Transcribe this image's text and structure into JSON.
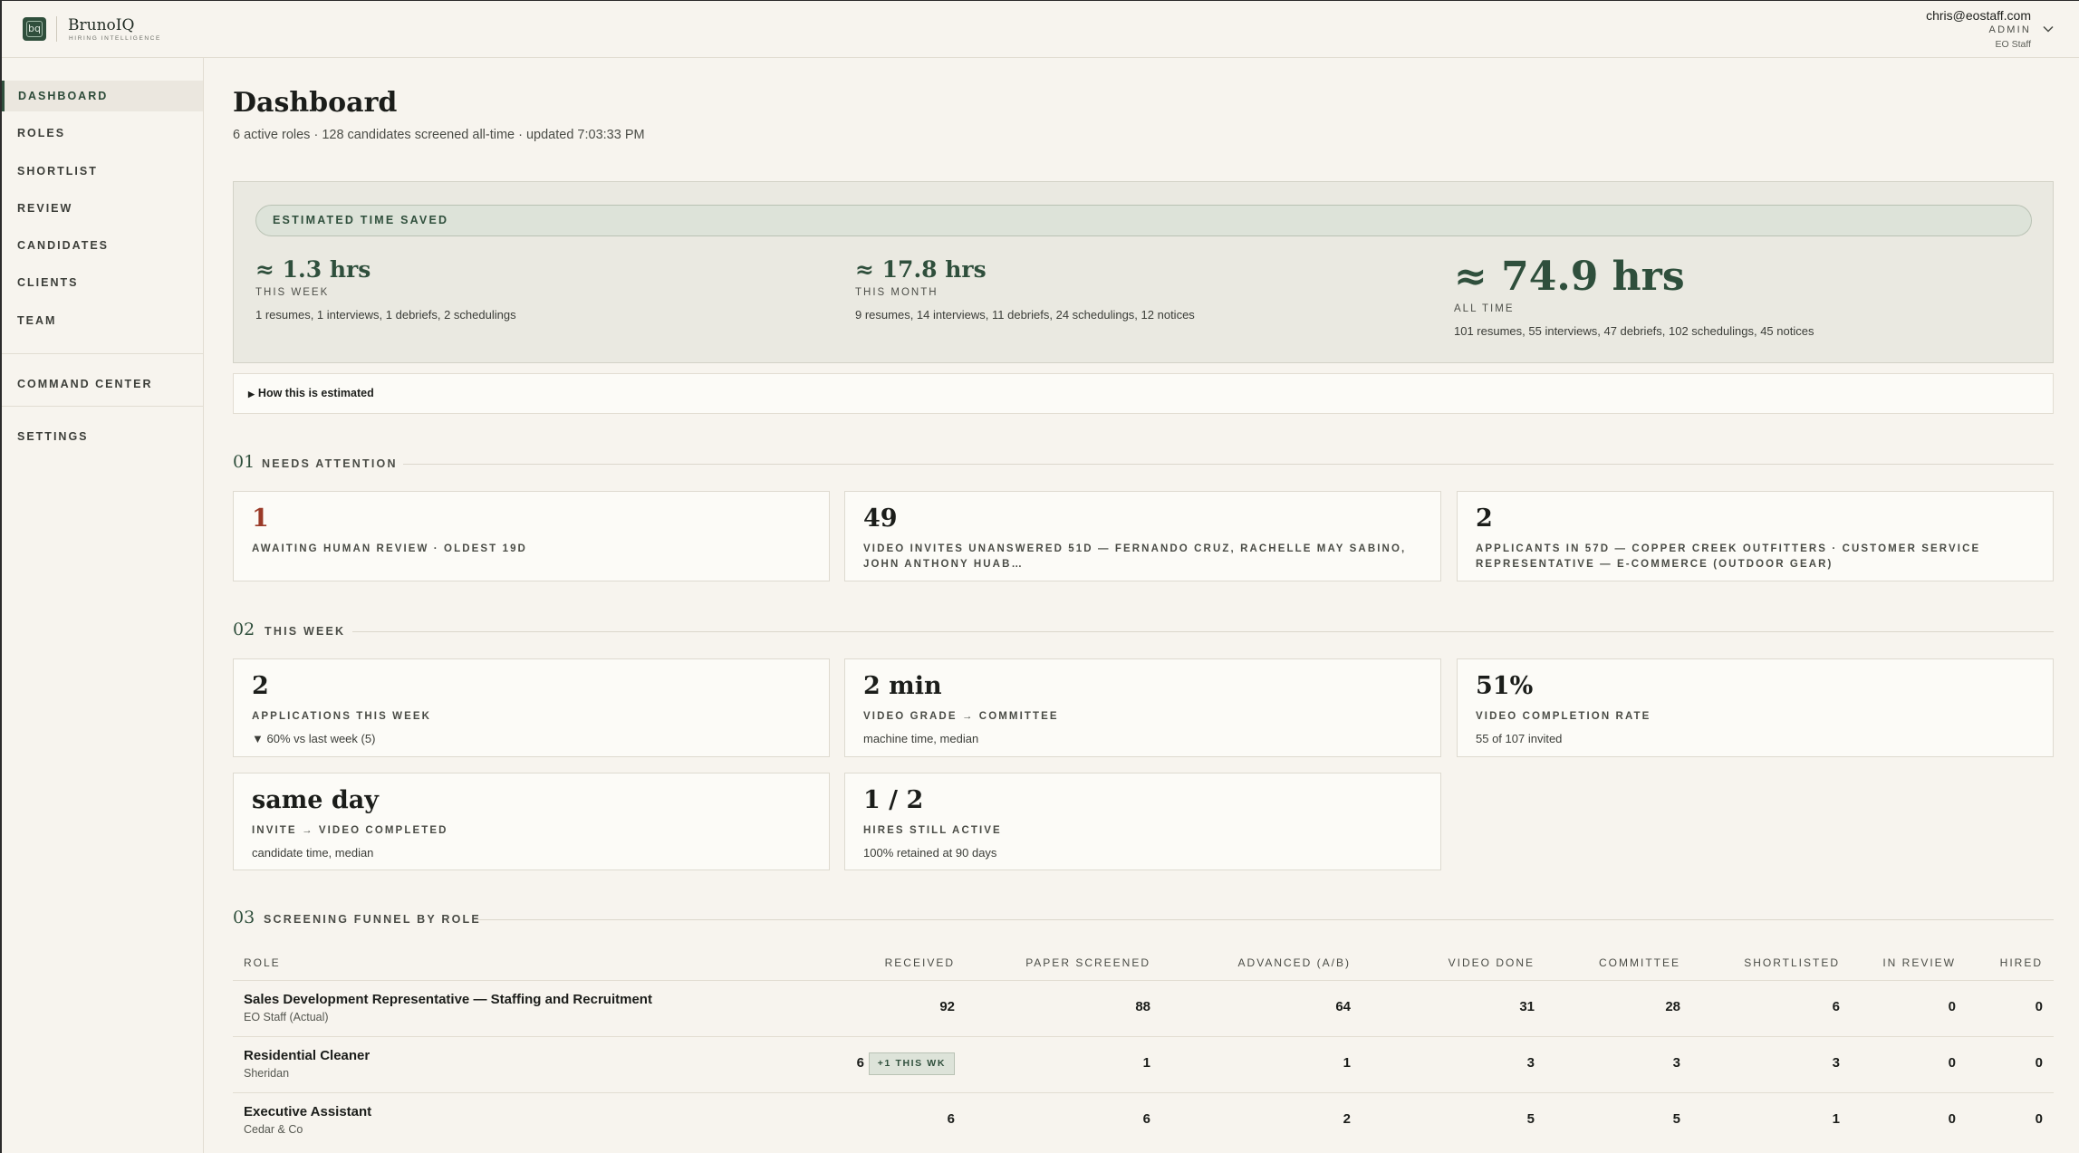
{
  "brand": {
    "mark": "bq",
    "name": "BrunoIQ",
    "tagline": "HIRING INTELLIGENCE"
  },
  "user": {
    "email": "chris@eostaff.com",
    "role": "ADMIN",
    "org": "EO Staff"
  },
  "sidebar": {
    "items": [
      {
        "label": "DASHBOARD",
        "active": true
      },
      {
        "label": "ROLES"
      },
      {
        "label": "SHORTLIST"
      },
      {
        "label": "REVIEW"
      },
      {
        "label": "CANDIDATES"
      },
      {
        "label": "CLIENTS"
      },
      {
        "label": "TEAM"
      }
    ],
    "command_center": "COMMAND CENTER",
    "settings": "SETTINGS"
  },
  "page": {
    "title": "Dashboard",
    "subtitle": "6 active roles · 128 candidates screened all-time · updated 7:03:33 PM"
  },
  "time_saved": {
    "heading": "ESTIMATED TIME SAVED",
    "week": {
      "value": "≈ 1.3 hrs",
      "label": "THIS WEEK",
      "desc": "1 resumes, 1 interviews, 1 debriefs, 2 schedulings"
    },
    "month": {
      "value": "≈ 17.8 hrs",
      "label": "THIS MONTH",
      "desc": "9 resumes, 14 interviews, 11 debriefs, 24 schedulings, 12 notices"
    },
    "all": {
      "value": "≈ 74.9 hrs",
      "label": "ALL TIME",
      "desc": "101 resumes, 55 interviews, 47 debriefs, 102 schedulings, 45 notices"
    },
    "how": "How this is estimated"
  },
  "needs_attention": {
    "num": "01",
    "title": "NEEDS ATTENTION",
    "cards": [
      {
        "value": "1",
        "label": "AWAITING HUMAN REVIEW · OLDEST 19D"
      },
      {
        "value": "49",
        "label": "VIDEO INVITES UNANSWERED 51D — FERNANDO CRUZ, RACHELLE MAY SABINO, JOHN ANTHONY HUAB…"
      },
      {
        "value": "2",
        "label": "APPLICANTS IN 57D — COPPER CREEK OUTFITTERS · CUSTOMER SERVICE REPRESENTATIVE — E-COMMERCE (OUTDOOR GEAR)"
      }
    ]
  },
  "this_week": {
    "num": "02",
    "title": "THIS WEEK",
    "cards": [
      {
        "value": "2",
        "label": "APPLICATIONS THIS WEEK",
        "note": "▼ 60% vs last week (5)"
      },
      {
        "value": "2 min",
        "label": "VIDEO GRADE → COMMITTEE",
        "note": "machine time, median"
      },
      {
        "value": "51%",
        "label": "VIDEO COMPLETION RATE",
        "note": "55 of 107 invited"
      },
      {
        "value": "same day",
        "label": "INVITE → VIDEO COMPLETED",
        "note": "candidate time, median"
      },
      {
        "value": "1 / 2",
        "label": "HIRES STILL ACTIVE",
        "note": "100% retained at 90 days"
      }
    ]
  },
  "funnel": {
    "num": "03",
    "title": "SCREENING FUNNEL BY ROLE",
    "columns": [
      "ROLE",
      "RECEIVED",
      "PAPER SCREENED",
      "ADVANCED (A/B)",
      "VIDEO DONE",
      "COMMITTEE",
      "SHORTLISTED",
      "IN REVIEW",
      "HIRED"
    ],
    "rows": [
      {
        "role": "Sales Development Representative — Staffing and Recruitment",
        "client": "EO Staff (Actual)",
        "tag": "",
        "values": [
          "92",
          "88",
          "64",
          "31",
          "28",
          "6",
          "0",
          "0"
        ]
      },
      {
        "role": "Residential Cleaner",
        "client": "Sheridan",
        "tag": "+1 THIS WK",
        "values": [
          "6",
          "1",
          "1",
          "3",
          "3",
          "3",
          "0",
          "0"
        ]
      },
      {
        "role": "Executive Assistant",
        "client": "Cedar & Co",
        "tag": "",
        "values": [
          "6",
          "6",
          "2",
          "5",
          "5",
          "1",
          "0",
          "0"
        ]
      }
    ]
  },
  "colors": {
    "accent": "#2f4f3c",
    "alert": "#9a3a28",
    "background": "#f7f4ee"
  }
}
